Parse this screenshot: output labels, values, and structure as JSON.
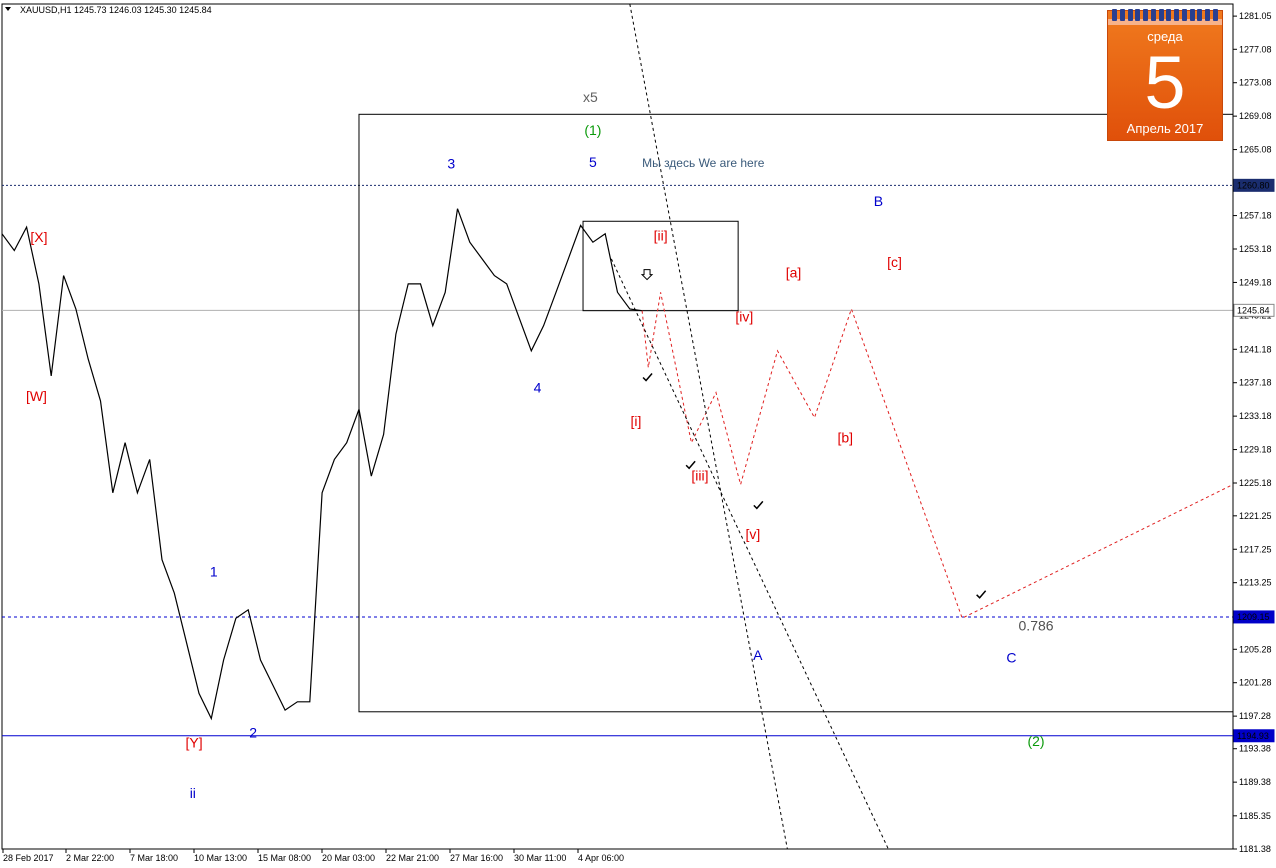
{
  "header": {
    "menu_icon": "triangle-down-icon",
    "text": "XAUUSD,H1  1245.73 1246.03 1245.30 1245.84"
  },
  "calendar": {
    "weekday": "среда",
    "day": "5",
    "month": "Апрель 2017",
    "color": "#e8600f"
  },
  "chart_data": {
    "type": "line",
    "symbol": "XAUUSD",
    "timeframe": "H1",
    "ohlc_last": {
      "open": 1245.73,
      "high": 1246.03,
      "low": 1245.3,
      "close": 1245.84
    },
    "ylim": [
      1181.38,
      1282.5
    ],
    "y_ticks": [
      "1281.05",
      "1277.08",
      "1273.08",
      "1269.08",
      "1265.08",
      "1261.11",
      "1257.18",
      "1253.18",
      "1249.18",
      "1245.21",
      "1241.18",
      "1237.18",
      "1233.18",
      "1229.18",
      "1225.18",
      "1221.25",
      "1217.25",
      "1213.25",
      "1209.25",
      "1205.28",
      "1201.28",
      "1197.28",
      "1193.38",
      "1189.38",
      "1185.35",
      "1181.38"
    ],
    "x_ticks": [
      "28 Feb 2017",
      "2 Mar 22:00",
      "7 Mar 18:00",
      "10 Mar 13:00",
      "15 Mar 08:00",
      "20 Mar 03:00",
      "22 Mar 21:00",
      "27 Mar 16:00",
      "30 Mar 11:00",
      "4 Apr 06:00"
    ],
    "horizontal_levels": [
      {
        "value": 1260.8,
        "label": "1260.80",
        "style": "dotted",
        "color": "#1a2d6e"
      },
      {
        "value": 1245.84,
        "label": "1245.84",
        "style": "solid",
        "color": "#b0b0b0"
      },
      {
        "value": 1209.15,
        "label": "1209.15",
        "style": "dashed",
        "color": "#0000d0"
      },
      {
        "value": 1194.93,
        "label": "1194.93",
        "style": "solid",
        "color": "#0000d0"
      }
    ],
    "price_series": {
      "name": "XAUUSD,H1",
      "points": [
        [
          0,
          1255
        ],
        [
          0.01,
          1253
        ],
        [
          0.02,
          1255.8
        ],
        [
          0.03,
          1249
        ],
        [
          0.04,
          1238
        ],
        [
          0.05,
          1250
        ],
        [
          0.06,
          1246
        ],
        [
          0.07,
          1240
        ],
        [
          0.08,
          1235
        ],
        [
          0.09,
          1224
        ],
        [
          0.1,
          1230
        ],
        [
          0.11,
          1224
        ],
        [
          0.12,
          1228
        ],
        [
          0.13,
          1216
        ],
        [
          0.14,
          1212
        ],
        [
          0.15,
          1206
        ],
        [
          0.16,
          1200
        ],
        [
          0.17,
          1197
        ],
        [
          0.18,
          1204
        ],
        [
          0.19,
          1209
        ],
        [
          0.2,
          1210
        ],
        [
          0.21,
          1204
        ],
        [
          0.22,
          1201
        ],
        [
          0.23,
          1198
        ],
        [
          0.24,
          1199
        ],
        [
          0.25,
          1199
        ],
        [
          0.26,
          1224
        ],
        [
          0.27,
          1228
        ],
        [
          0.28,
          1230
        ],
        [
          0.29,
          1234
        ],
        [
          0.3,
          1226
        ],
        [
          0.31,
          1231
        ],
        [
          0.32,
          1243
        ],
        [
          0.33,
          1249
        ],
        [
          0.34,
          1249
        ],
        [
          0.35,
          1244
        ],
        [
          0.36,
          1248
        ],
        [
          0.37,
          1258
        ],
        [
          0.38,
          1254
        ],
        [
          0.39,
          1252
        ],
        [
          0.4,
          1250
        ],
        [
          0.41,
          1249
        ],
        [
          0.42,
          1245
        ],
        [
          0.43,
          1241
        ],
        [
          0.44,
          1244
        ],
        [
          0.45,
          1248
        ],
        [
          0.46,
          1252
        ],
        [
          0.47,
          1256
        ],
        [
          0.48,
          1254
        ],
        [
          0.49,
          1255
        ],
        [
          0.5,
          1248
        ],
        [
          0.51,
          1246
        ],
        [
          0.52,
          1245.8
        ]
      ]
    },
    "projection_points": [
      [
        0.52,
        1245.8
      ],
      [
        0.525,
        1239
      ],
      [
        0.535,
        1248
      ],
      [
        0.56,
        1230
      ],
      [
        0.58,
        1236
      ],
      [
        0.6,
        1225
      ],
      [
        0.63,
        1241
      ],
      [
        0.66,
        1233
      ],
      [
        0.69,
        1246
      ],
      [
        0.78,
        1209
      ],
      [
        1.0,
        1225
      ]
    ],
    "projection_color": "#e02020",
    "rectangles": [
      {
        "x0": 0.29,
        "x1": 1.0,
        "y0": 1197.8,
        "y1": 1269.3,
        "color": "#000000"
      },
      {
        "x0": 0.472,
        "x1": 0.598,
        "y0": 1245.8,
        "y1": 1256.5,
        "color": "#000000"
      }
    ],
    "trend_lines": [
      {
        "from": [
          0.51,
          1282.5
        ],
        "to": [
          0.638,
          1181.38
        ],
        "style": "dashed",
        "color": "#000000"
      },
      {
        "from": [
          0.495,
          1252
        ],
        "to": [
          0.72,
          1181.38
        ],
        "style": "dashed",
        "color": "#000000"
      }
    ],
    "wave_labels": [
      {
        "text": "[X]",
        "color": "#e00000",
        "x": 0.03,
        "y": 1254
      },
      {
        "text": "[W]",
        "color": "#e00000",
        "x": 0.028,
        "y": 1235
      },
      {
        "text": "[Y]",
        "color": "#e00000",
        "x": 0.156,
        "y": 1193.5
      },
      {
        "text": "ii",
        "color": "#0000cc",
        "x": 0.155,
        "y": 1187.5
      },
      {
        "text": "1",
        "color": "#0000cc",
        "x": 0.172,
        "y": 1214
      },
      {
        "text": "2",
        "color": "#0000cc",
        "x": 0.204,
        "y": 1194.7
      },
      {
        "text": "3",
        "color": "#0000cc",
        "x": 0.365,
        "y": 1262.8
      },
      {
        "text": "4",
        "color": "#0000cc",
        "x": 0.435,
        "y": 1236
      },
      {
        "text": "5",
        "color": "#0000cc",
        "x": 0.48,
        "y": 1263
      },
      {
        "text": "x5",
        "color": "#606060",
        "x": 0.478,
        "y": 1270.8
      },
      {
        "text": "(1)",
        "color": "#0a9a0a",
        "x": 0.48,
        "y": 1266.8
      },
      {
        "text": "Мы здесь We are here",
        "color": "#3a5a7a",
        "x": 0.52,
        "y": 1263
      },
      {
        "text": "[ii]",
        "color": "#e00000",
        "x": 0.535,
        "y": 1254.2
      },
      {
        "text": "[i]",
        "color": "#e00000",
        "x": 0.515,
        "y": 1232
      },
      {
        "text": "[iii]",
        "color": "#e00000",
        "x": 0.567,
        "y": 1225.5
      },
      {
        "text": "[iv]",
        "color": "#e00000",
        "x": 0.603,
        "y": 1244.5
      },
      {
        "text": "[v]",
        "color": "#e00000",
        "x": 0.61,
        "y": 1218.5
      },
      {
        "text": "[a]",
        "color": "#e00000",
        "x": 0.643,
        "y": 1249.8
      },
      {
        "text": "[b]",
        "color": "#e00000",
        "x": 0.685,
        "y": 1230
      },
      {
        "text": "[c]",
        "color": "#e00000",
        "x": 0.725,
        "y": 1251
      },
      {
        "text": "A",
        "color": "#0000cc",
        "x": 0.614,
        "y": 1204
      },
      {
        "text": "B",
        "color": "#0000cc",
        "x": 0.712,
        "y": 1258.3
      },
      {
        "text": "C",
        "color": "#0000cc",
        "x": 0.82,
        "y": 1203.7
      },
      {
        "text": "0.786",
        "color": "#505050",
        "x": 0.84,
        "y": 1207.5
      },
      {
        "text": "(2)",
        "color": "#0a9a0a",
        "x": 0.84,
        "y": 1193.7
      }
    ],
    "check_marks": [
      [
        0.524,
        1237.8
      ],
      [
        0.559,
        1227.3
      ],
      [
        0.614,
        1222.5
      ],
      [
        0.795,
        1211.8
      ]
    ],
    "arrow_mark": {
      "x": 0.524,
      "y": 1250,
      "icon": "arrow-down-icon"
    }
  }
}
